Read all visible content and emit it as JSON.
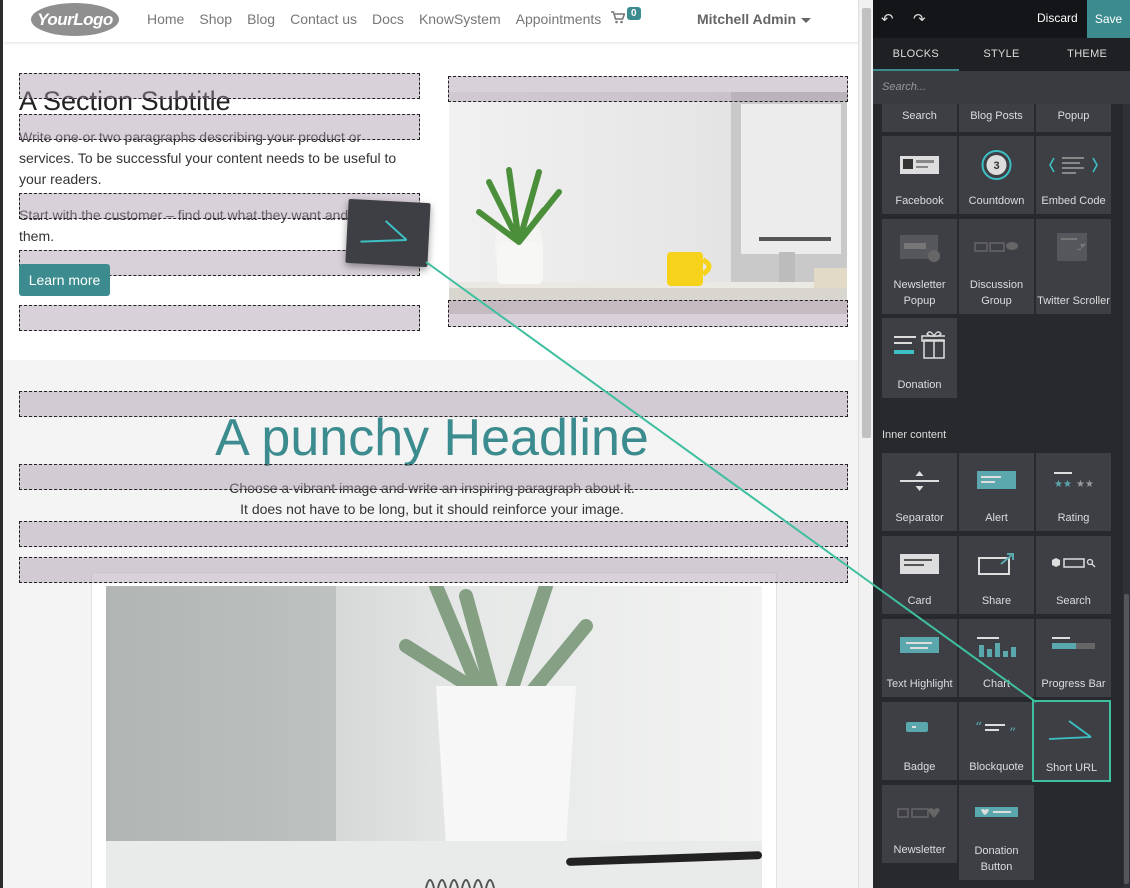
{
  "nav": {
    "logo": "YourLogo",
    "items": [
      "Home",
      "Shop",
      "Blog",
      "Contact us",
      "Docs",
      "KnowSystem",
      "Appointments"
    ],
    "cart_count": "0",
    "user": "Mitchell Admin"
  },
  "section1": {
    "subtitle": "A Section Subtitle",
    "para1": "Write one or two paragraphs describing your product or services. To be successful your content needs to be useful to your readers.",
    "para2": "Start with the customer – find out what they want and give it to them.",
    "button": "Learn more"
  },
  "section2": {
    "headline": "A punchy Headline",
    "line1": "Choose a vibrant image and write an inspiring paragraph about it.",
    "line2": "It does not have to be long, but it should reinforce your image."
  },
  "editor": {
    "discard": "Discard",
    "save": "Save",
    "tabs": [
      "BLOCKS",
      "STYLE",
      "THEME"
    ],
    "search_placeholder": "Search...",
    "top_row": [
      "Search",
      "Blog Posts",
      "Popup"
    ],
    "dynamic_blocks": [
      "Facebook",
      "Countdown",
      "Embed Code",
      "Newsletter Popup",
      "Discussion Group",
      "Twitter Scroller",
      "Donation"
    ],
    "inner_content_label": "Inner content",
    "inner_blocks": [
      "Separator",
      "Alert",
      "Rating",
      "Card",
      "Share",
      "Search",
      "Text Highlight",
      "Chart",
      "Progress Bar",
      "Badge",
      "Blockquote",
      "Short URL",
      "Newsletter",
      "Donation Button"
    ],
    "selected_block": "Short URL",
    "countdown_number": "3"
  },
  "colors": {
    "accent": "#3c8c8f",
    "panel_bg": "#28292d",
    "block_bg": "#3d3f45",
    "drag_line": "#3ebf9f"
  }
}
